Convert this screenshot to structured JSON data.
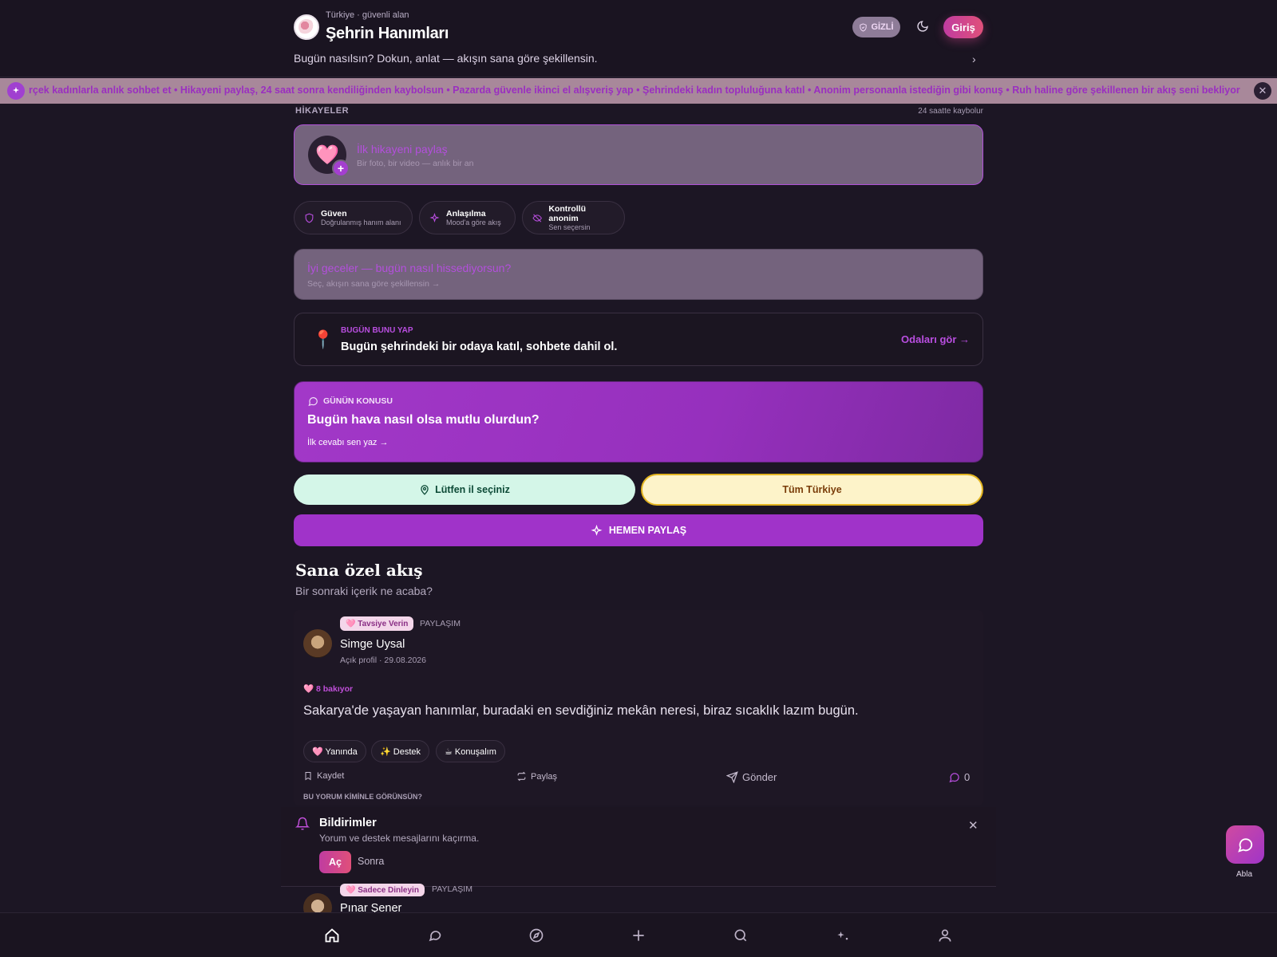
{
  "header": {
    "subtitle": "Türkiye · güvenli alan",
    "title": "Şehrin Hanımları",
    "gizli_label": "GİZLİ",
    "login_label": "Giriş",
    "mood_prompt": "Bugün nasılsın? Dokun, anlat — akışın sana göre şekillensin."
  },
  "ticker": {
    "text": "rçek kadınlarla anlık sohbet et • Hikayeni paylaş, 24 saat sonra kendiliğinden kaybolsun • Pazarda güvenle ikinci el alışveriş yap • Şehrindeki kadın topluluğuna katıl • Anonim personanla istediğin gibi konuş • Ruh haline göre şekillenen bir akış seni bekliyor"
  },
  "stories": {
    "label": "HİKAYELER",
    "expiry_note": "24 saatte kaybolur",
    "cta_title": "İlk hikayeni paylaş",
    "cta_sub": "Bir foto, bir video — anlık bir an"
  },
  "features": [
    {
      "title": "Güven",
      "sub": "Doğrulanmış hanım alanı",
      "icon": "shield-icon"
    },
    {
      "title": "Anlaşılma",
      "sub": "Mood'a göre akış",
      "icon": "sparkles-icon"
    },
    {
      "title": "Kontrollü anonim",
      "sub": "Sen seçersin",
      "icon": "eye-off-icon"
    }
  ],
  "mood_card": {
    "title": "İyi geceler — bugün nasıl hissediyorsun?",
    "sub": "Seç, akışın sana göre şekillensin →"
  },
  "todo": {
    "label": "BUGÜN BUNU YAP",
    "title": "Bugün şehrindeki bir odaya katıl, sohbete dahil ol.",
    "link": "Odaları gör →"
  },
  "topic": {
    "label": "GÜNÜN KONUSU",
    "title": "Bugün hava nasıl olsa mutlu olurdun?",
    "link": "İlk cevabı sen yaz →"
  },
  "location": {
    "city_label": "Lütfen il seçiniz",
    "all_label": "Tüm Türkiye"
  },
  "share_label": "HEMEN PAYLAŞ",
  "feed": {
    "title": "Sana özel akış",
    "subtitle": "Bir sonraki içerik ne acaba?"
  },
  "post": {
    "badge": "🩷 Tavsiye Verin",
    "type": "PAYLAŞIM",
    "author": "Simge Uysal",
    "meta": "Açık profil · 29.08.2026",
    "looking": "🩷 8 bakıyor",
    "body": "Sakarya'de yaşayan hanımlar, buradaki en sevdiğiniz mekân neresi, biraz sıcaklık lazım bugün.",
    "reactions": [
      "🩷  Yanında",
      "✨  Destek",
      "☕  Konuşalım"
    ],
    "actions": {
      "save": "Kaydet",
      "share": "Paylaş",
      "send": "Gönder",
      "comments": "0"
    },
    "visibility_q": "BU YORUM KİMİNLE GÖRÜNSÜN?"
  },
  "notification": {
    "title": "Bildirimler",
    "sub": "Yorum ve destek mesajlarını kaçırma.",
    "accept": "Aç",
    "later": "Sonra"
  },
  "post2": {
    "badge": "🩷 Sadece Dinleyin",
    "type": "PAYLAŞIM",
    "author": "Pınar Şener"
  },
  "fab_label": "Abla",
  "colors": {
    "accent": "#a033c9",
    "brand_pink": "#e0507a",
    "bg": "#1c1624"
  }
}
